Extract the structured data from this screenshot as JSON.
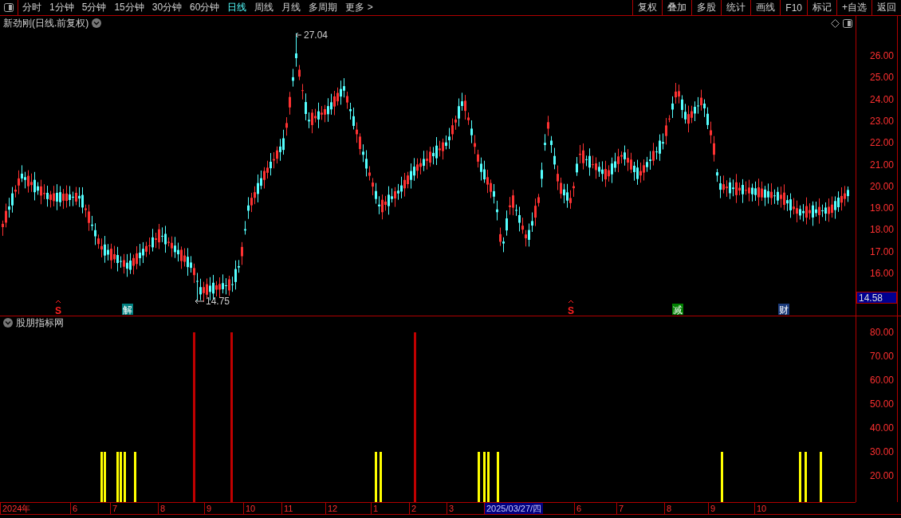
{
  "toolbar": {
    "periods": [
      {
        "label": "分时",
        "selected": false
      },
      {
        "label": "1分钟",
        "selected": false
      },
      {
        "label": "5分钟",
        "selected": false
      },
      {
        "label": "15分钟",
        "selected": false
      },
      {
        "label": "30分钟",
        "selected": false
      },
      {
        "label": "60分钟",
        "selected": false
      },
      {
        "label": "日线",
        "selected": true
      },
      {
        "label": "周线",
        "selected": false
      },
      {
        "label": "月线",
        "selected": false
      },
      {
        "label": "多周期",
        "selected": false
      },
      {
        "label": "更多 >",
        "selected": false
      }
    ],
    "actions": [
      "复权",
      "叠加",
      "多股",
      "统计",
      "画线",
      "F10",
      "标记",
      "+自选",
      "返回"
    ]
  },
  "main_chart": {
    "title": "新劲刚(日线.前复权)",
    "high_label": "27.04",
    "low_label": "14.75",
    "current_price": "14.58",
    "y_ticks": [
      "26.00",
      "25.00",
      "24.00",
      "23.00",
      "22.00",
      "21.00",
      "20.00",
      "19.00",
      "18.00",
      "17.00",
      "16.00"
    ],
    "markers": [
      {
        "label": "S",
        "kind": "signal",
        "color": "#ff2020"
      },
      {
        "label": "解",
        "kind": "event",
        "color": "#008080"
      },
      {
        "label": "S",
        "kind": "signal",
        "color": "#ff2020"
      },
      {
        "label": "减",
        "kind": "event",
        "color": "#008000"
      },
      {
        "label": "财",
        "kind": "event",
        "color": "#1a3a7a"
      }
    ]
  },
  "indicator": {
    "title": "股朋指标网",
    "y_ticks": [
      "80.00",
      "70.00",
      "60.00",
      "50.00",
      "40.00",
      "30.00",
      "20.00"
    ]
  },
  "date_axis": [
    {
      "label": "2024年",
      "selected": false
    },
    {
      "label": "6",
      "selected": false
    },
    {
      "label": "7",
      "selected": false
    },
    {
      "label": "8",
      "selected": false
    },
    {
      "label": "9",
      "selected": false
    },
    {
      "label": "10",
      "selected": false
    },
    {
      "label": "11",
      "selected": false
    },
    {
      "label": "12",
      "selected": false
    },
    {
      "label": "1",
      "selected": false
    },
    {
      "label": "2",
      "selected": false
    },
    {
      "label": "3",
      "selected": false
    },
    {
      "label": "2025/03/27/四",
      "selected": true
    },
    {
      "label": "6",
      "selected": false
    },
    {
      "label": "7",
      "selected": false
    },
    {
      "label": "8",
      "selected": false
    },
    {
      "label": "9",
      "selected": false
    },
    {
      "label": "10",
      "selected": false
    }
  ]
}
